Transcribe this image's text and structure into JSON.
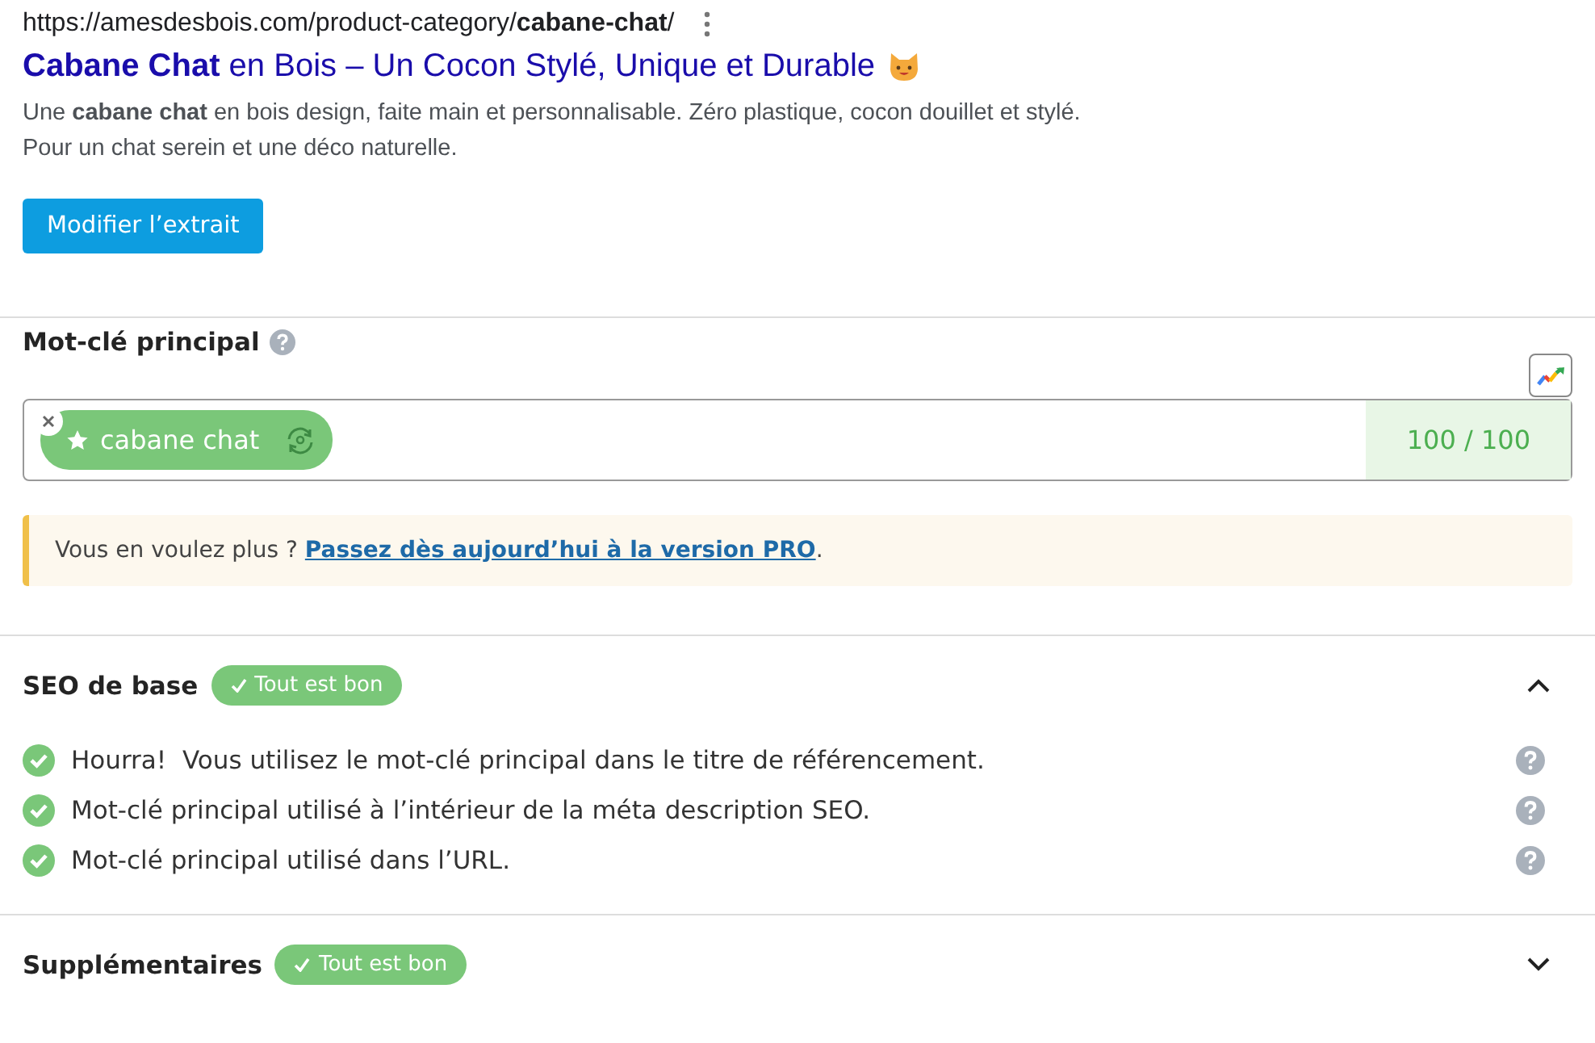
{
  "snippet": {
    "url": "https://amesdesbois.com/product-category/**cabane-chat**/",
    "title": "**Cabane Chat** en Bois – Un Cocon Stylé, Unique et Durable",
    "description": [
      "Une **cabane chat** en bois design, faite main et personnalisable. Zéro plastique, cocon douillet et stylé.",
      "Pour un chat serein et une déco naturelle."
    ],
    "edit_button": "Modifier l’extrait"
  },
  "focus_keyword": {
    "label": "Mot-clé principal",
    "keyword": "cabane chat",
    "score": "100 / 100"
  },
  "notice": {
    "text": "Vous en voulez plus ?",
    "link": "Passez dès aujourd’hui à la version PRO",
    "end": "."
  },
  "sections": [
    {
      "title": "SEO de base",
      "badge": "Tout est bon",
      "expanded": true,
      "checks": [
        {
          "text": "Hourra!  Vous utilisez le mot-clé principal dans le titre de référencement.",
          "passed": true
        },
        {
          "text": "Mot-clé principal utilisé à l’intérieur de la méta description SEO.",
          "passed": true
        },
        {
          "text": "Mot-clé principal utilisé dans l’URL.",
          "passed": true
        }
      ]
    },
    {
      "title": "Supplémentaires",
      "badge": "Tout est bon",
      "expanded": false
    }
  ]
}
